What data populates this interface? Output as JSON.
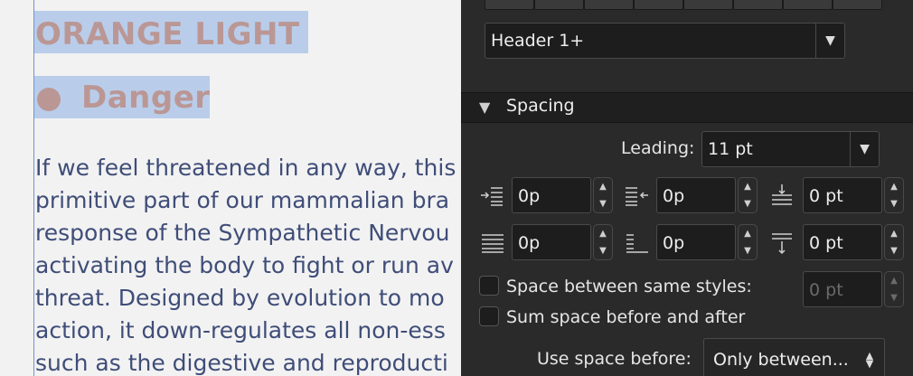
{
  "document": {
    "heading": "ORANGE LIGHT",
    "subheading": "Danger",
    "body_lines": [
      "If we feel threatened in any way, this",
      "primitive part of our mammalian bra",
      "response of the Sympathetic Nervou",
      "activating the body to fight or run av",
      "threat. Designed by evolution to mo",
      "action, it down-regulates all non-ess",
      "such as the digestive and reproducti"
    ]
  },
  "panel": {
    "style_select": "Header 1+",
    "spacing": {
      "section_label": "Spacing",
      "leading_label": "Leading:",
      "leading_value": "11 pt",
      "fields": {
        "indent_left": "0p",
        "indent_right": "0p",
        "space_before": "0 pt",
        "first_line": "0p",
        "last_line": "0p",
        "space_after": "0 pt"
      },
      "space_between_label": "Space between same styles:",
      "space_between_value": "0 pt",
      "sum_space_label": "Sum space before and after",
      "use_space_before_label": "Use space before:",
      "use_space_before_value": "Only between..."
    }
  }
}
